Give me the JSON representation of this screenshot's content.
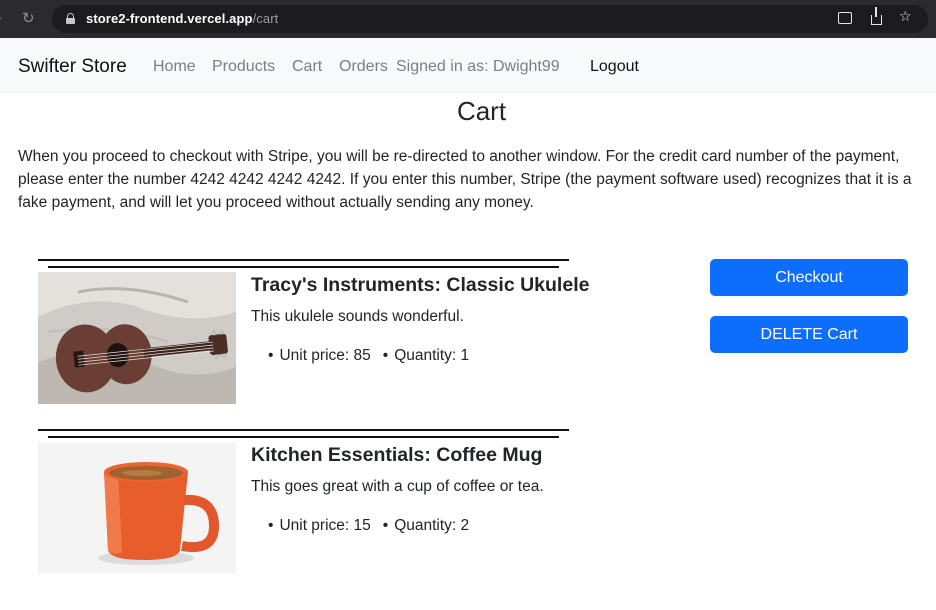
{
  "browser": {
    "url_host": "store2-frontend.vercel.app",
    "url_path": "/cart"
  },
  "navbar": {
    "brand": "Swifter Store",
    "links": [
      "Home",
      "Products",
      "Cart",
      "Orders"
    ],
    "signed_in": "Signed in as: Dwight99",
    "logout": "Logout"
  },
  "main": {
    "title": "Cart",
    "intro": "When you proceed to checkout with Stripe, you will be re-directed to another window. For the credit card number of the payment, please enter the number 4242 4242 4242 4242. If you enter this number, Stripe (the payment software used) recognizes that it is a fake payment, and will let you proceed without actually sending any money."
  },
  "cart_items": [
    {
      "name": "Tracy's Instruments: Classic Ukulele",
      "description": "This ukulele sounds wonderful.",
      "unit_price": "Unit price: 85",
      "quantity": "Quantity: 1"
    },
    {
      "name": "Kitchen Essentials: Coffee Mug",
      "description": "This goes great with a cup of coffee or tea.",
      "unit_price": "Unit price: 15",
      "quantity": "Quantity: 2"
    }
  ],
  "actions": {
    "checkout": "Checkout",
    "delete_cart": "DELETE Cart"
  },
  "colors": {
    "primary": "#0d6efd",
    "navbar_bg": "#f8f9fa",
    "browser_bg": "#2b2b2e"
  },
  "icons": [
    "forward-arrow-icon",
    "reload-icon",
    "lock-icon",
    "cast-icon",
    "share-icon",
    "star-icon"
  ]
}
